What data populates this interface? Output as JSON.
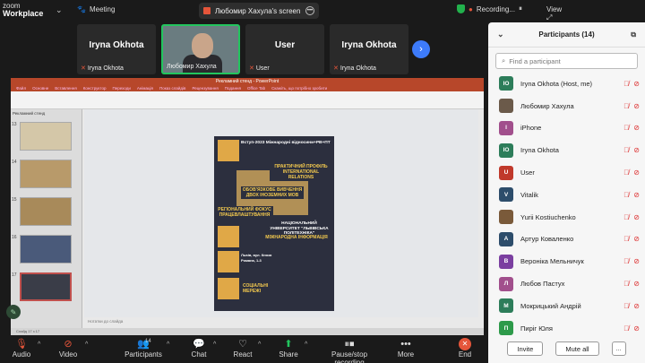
{
  "app": {
    "name_line1": "zoom",
    "name_line2": "Workplace",
    "meeting_label": "Meeting"
  },
  "share": {
    "title": "Любомир Хахула's screen",
    "recording_label": "Recording...",
    "view_label": "View"
  },
  "video_strip": [
    {
      "display": "Iryna Okhota",
      "name": "Iryna Okhota",
      "muted": true
    },
    {
      "display": "",
      "name": "Любомир Хахула",
      "muted": false,
      "active": true
    },
    {
      "display": "User",
      "name": "User",
      "muted": true
    },
    {
      "display": "Iryna Okhota",
      "name": "Iryna Okhota",
      "muted": true
    }
  ],
  "powerpoint": {
    "title": "Рекламний стенд - PowerPoint",
    "tabs": [
      "Файл",
      "Основне",
      "Вставлення",
      "Конструктор",
      "Переходи",
      "Анімація",
      "Показ слайдів",
      "Рецензування",
      "Подання",
      "Office Tab",
      "Скажіть, що потрібно зробити"
    ],
    "side_label": "Рекламний стенд",
    "thumb_numbers": [
      "13",
      "14",
      "15",
      "16",
      "17"
    ],
    "notes_placeholder": "Нотатки до слайда",
    "status": "Слайд 17 з 17",
    "slide": {
      "heading": "Вступ-2023 Міжнародні відносини+РВ+ПТ",
      "box1": "ПРАКТИЧНИЙ ПРОФІЛЬ INTERNATIONAL RELATIONS",
      "box2": "ОБОВ'ЯЗКОВЕ ВИВЧЕННЯ ДВОХ ІНОЗЕМНИХ МОВ",
      "box3": "РЕГІОНАЛЬНИЙ ФОКУС ПРАЦЕВЛАШТУВАННЯ",
      "box4": "НАЦІОНАЛЬНИЙ УНІВЕРСИТЕТ \"ЛЬВІВСЬКА ПОЛІТЕХНІКА\"",
      "box5": "МІЖНАРОДНА ІНФОРМАЦІЯ",
      "contacts": "Львів, вул. Князя Романа, 1-3",
      "social": "СОЦІАЛЬНІ МЕРЕЖІ"
    }
  },
  "toolbar": {
    "audio": "Audio",
    "video": "Video",
    "participants": "Participants",
    "participants_count": "14",
    "chat": "Chat",
    "react": "React",
    "share": "Share",
    "pause_recording": "Pause/stop recording",
    "more": "More",
    "end": "End"
  },
  "panel": {
    "title": "Participants (14)",
    "search_placeholder": "Find a participant",
    "participants": [
      {
        "initials": "IO",
        "name": "Iryna Okhota (Host, me)",
        "color": "#2d7d5a"
      },
      {
        "initials": "",
        "name": "Любомир Хахула",
        "color": "#6b5a4a"
      },
      {
        "initials": "I",
        "name": "iPhone",
        "color": "#a14f8c"
      },
      {
        "initials": "IO",
        "name": "Iryna Okhota",
        "color": "#2d7d5a"
      },
      {
        "initials": "U",
        "name": "User",
        "color": "#c0392b"
      },
      {
        "initials": "V",
        "name": "Vitalik",
        "color": "#2d4d6b"
      },
      {
        "initials": "",
        "name": "Yurii Kostiuchenko",
        "color": "#7a5a3a"
      },
      {
        "initials": "A",
        "name": "Артур Коваленко",
        "color": "#2d4d6b"
      },
      {
        "initials": "B",
        "name": "Вероніка Мельничук",
        "color": "#7b3fa0"
      },
      {
        "initials": "Л",
        "name": "Любов Пастух",
        "color": "#a14f8c"
      },
      {
        "initials": "М",
        "name": "Мокрицький Андрій",
        "color": "#2d7d5a"
      },
      {
        "initials": "П",
        "name": "Пиріг Юля",
        "color": "#2d9a4a"
      }
    ],
    "invite": "Invite",
    "mute_all": "Mute all",
    "more": "..."
  }
}
